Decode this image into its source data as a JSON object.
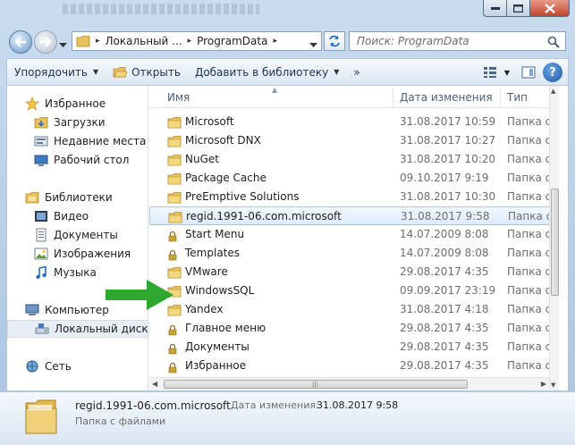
{
  "nav": {
    "address_segments": [
      "Локальный ...",
      "ProgramData"
    ],
    "search_placeholder": "Поиск: ProgramData"
  },
  "toolbar": {
    "organize": "Упорядочить",
    "open": "Открыть",
    "add_to_library": "Добавить в библиотеку",
    "more": "»"
  },
  "navpane": {
    "favorites": "Избранное",
    "downloads": "Загрузки",
    "recent": "Недавние места",
    "desktop": "Рабочий стол",
    "libraries": "Библиотеки",
    "video": "Видео",
    "documents": "Документы",
    "pictures": "Изображения",
    "music": "Музыка",
    "computer": "Компьютер",
    "local_disk": "Локальный диск (C",
    "network": "Сеть"
  },
  "columns": {
    "name": "Имя",
    "date": "Дата изменения",
    "type": "Тип"
  },
  "files": [
    {
      "name": "Microsoft",
      "date": "31.08.2017 10:59",
      "type": "Папка с ф",
      "locked": false
    },
    {
      "name": "Microsoft DNX",
      "date": "31.08.2017 10:27",
      "type": "Папка с ф",
      "locked": false
    },
    {
      "name": "NuGet",
      "date": "31.08.2017 10:20",
      "type": "Папка с ф",
      "locked": false
    },
    {
      "name": "Package Cache",
      "date": "09.10.2017 9:19",
      "type": "Папка с ф",
      "locked": false
    },
    {
      "name": "PreEmptive Solutions",
      "date": "31.08.2017 10:30",
      "type": "Папка с ф",
      "locked": false
    },
    {
      "name": "regid.1991-06.com.microsoft",
      "date": "31.08.2017 9:58",
      "type": "Папка с ф",
      "locked": false
    },
    {
      "name": "Start Menu",
      "date": "14.07.2009 8:08",
      "type": "Папка с ф",
      "locked": true
    },
    {
      "name": "Templates",
      "date": "14.07.2009 8:08",
      "type": "Папка с ф",
      "locked": true
    },
    {
      "name": "VMware",
      "date": "29.08.2017 4:35",
      "type": "Папка с ф",
      "locked": false
    },
    {
      "name": "WindowsSQL",
      "date": "09.09.2017 23:19",
      "type": "Папка с ф",
      "locked": false
    },
    {
      "name": "Yandex",
      "date": "31.08.2017 4:18",
      "type": "Папка с ф",
      "locked": false
    },
    {
      "name": "Главное меню",
      "date": "29.08.2017 4:35",
      "type": "Папка с ф",
      "locked": true
    },
    {
      "name": "Документы",
      "date": "29.08.2017 4:35",
      "type": "Папка с ф",
      "locked": true
    },
    {
      "name": "Избранное",
      "date": "29.08.2017 4:35",
      "type": "Папка с ф",
      "locked": true
    }
  ],
  "selected_index": 5,
  "details": {
    "name": "regid.1991-06.com.microsoft",
    "modified_label": "Дата изменения:",
    "modified_value": "31.08.2017 9:58",
    "type": "Папка с файлами"
  },
  "colors": {
    "folder": "#e8c25a",
    "arrow": "#2ea82e",
    "selection": "#dcebfc"
  }
}
